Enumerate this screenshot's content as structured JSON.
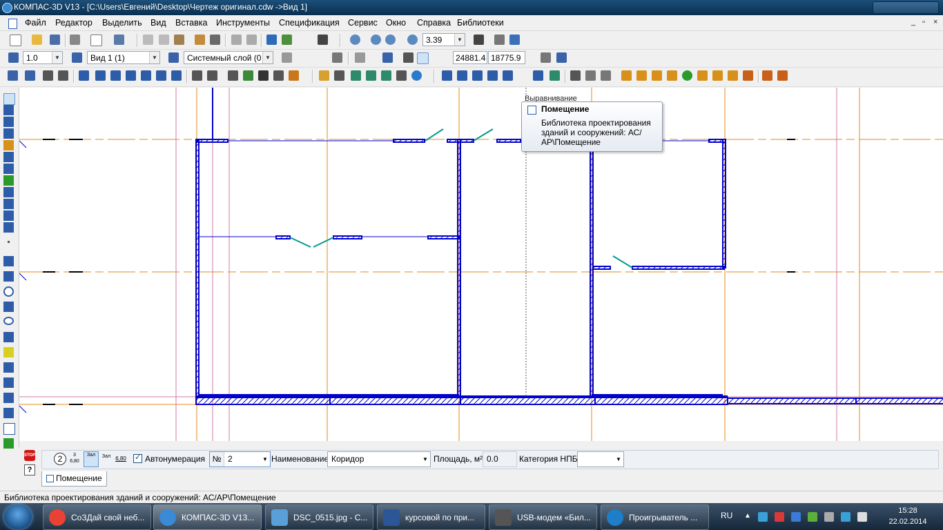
{
  "window": {
    "title": "КОМПАС-3D V13 - [C:\\Users\\Евгений\\Desktop\\Чертеж оригинал.cdw ->Вид 1]"
  },
  "menu": {
    "items": [
      "Файл",
      "Редактор",
      "Выделить",
      "Вид",
      "Вставка",
      "Инструменты",
      "Спецификация",
      "Сервис",
      "Окно",
      "Справка",
      "Библиотеки"
    ],
    "mdi_controls": [
      "_",
      "▫",
      "×"
    ]
  },
  "toolbar1": {
    "zoom_value": "3.39"
  },
  "toolbar2": {
    "scale": "1.0",
    "view": "Вид 1 (1)",
    "layer": "Системный слой (0",
    "coord_x": "24881.4",
    "coord_y": "18775.9"
  },
  "tooltip": {
    "header_fragment": "Выравнивание",
    "title": "Помещение",
    "body": "Библиотека проектирования зданий и сооружений: АС/АР\\Помещение"
  },
  "properties": {
    "autonumber_label": "Автонумерация",
    "autonumber_checked": true,
    "number_label": "№",
    "number_value": "2",
    "name_label": "Наименование",
    "name_value": "Коридор",
    "area_label": "Площадь, м²",
    "area_value": "0.0",
    "category_label": "Категория НПБ",
    "category_value": "",
    "tab_label": "Помещение",
    "mode_button_1": "2",
    "mode_button_2_top": "3",
    "mode_button_2_bottom": "6,80",
    "mode_button_3": "Зал",
    "mode_button_4": "Зал",
    "mode_button_5": "6,80"
  },
  "status": {
    "text": "Библиотека проектирования зданий и сооружений: АС/АР\\Помещение"
  },
  "taskbar": {
    "tasks": [
      {
        "label": "СоЗДай свой неб...",
        "icon": "chrome-icon",
        "color": "#e94235"
      },
      {
        "label": "КОМПАС-3D V13...",
        "icon": "kompas-icon",
        "color": "#3b8ad6"
      },
      {
        "label": "DSC_0515.jpg - С...",
        "icon": "photo-viewer-icon",
        "color": "#5aa0d8"
      },
      {
        "label": "курсовой по при...",
        "icon": "word-icon",
        "color": "#2b5797"
      },
      {
        "label": "USB-модем «Бил...",
        "icon": "modem-icon",
        "color": "#555555"
      },
      {
        "label": "Проигрыватель ...",
        "icon": "media-player-icon",
        "color": "#1e7ec8"
      }
    ],
    "language": "RU",
    "time": "15:28",
    "date": "22.02.2014"
  },
  "colors": {
    "wall": "#0000cc",
    "axis": "#e38a1a",
    "guide": "#d07aa8",
    "door": "#009a8a",
    "title_bar": "#0a2f4f"
  }
}
